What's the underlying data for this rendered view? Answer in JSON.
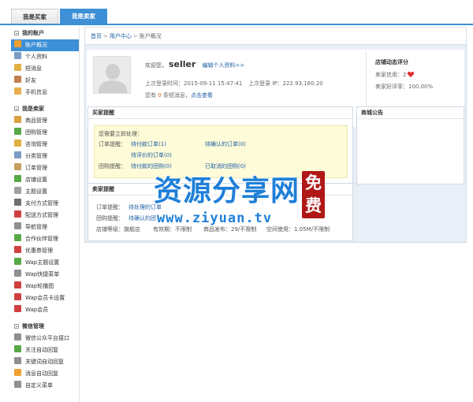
{
  "tabs": {
    "buyer": "我是买家",
    "seller": "我是卖家"
  },
  "sidebar": {
    "account": {
      "title": "我的账户",
      "items": [
        {
          "label": "账户概况",
          "icon": "home-icon",
          "color": "#f0a030",
          "active": true
        },
        {
          "label": "个人资料",
          "icon": "profile-icon",
          "color": "#7a9bc4"
        },
        {
          "label": "短消息",
          "icon": "message-icon",
          "color": "#e0b040"
        },
        {
          "label": "好友",
          "icon": "friends-icon",
          "color": "#c08050"
        },
        {
          "label": "手机信息",
          "icon": "phone-icon",
          "color": "#e8b050"
        }
      ]
    },
    "seller": {
      "title": "我是卖家",
      "items": [
        {
          "label": "商品管理",
          "icon": "goods-icon",
          "color": "#d9a040"
        },
        {
          "label": "团购管理",
          "icon": "groupbuy-icon",
          "color": "#58a848"
        },
        {
          "label": "咨询管理",
          "icon": "consult-icon",
          "color": "#e0b040"
        },
        {
          "label": "分类管理",
          "icon": "category-icon",
          "color": "#7a9bc4"
        },
        {
          "label": "订单管理",
          "icon": "order-icon",
          "color": "#c8a060"
        },
        {
          "label": "店铺设置",
          "icon": "shop-settings-icon",
          "color": "#58a848"
        },
        {
          "label": "主题设置",
          "icon": "theme-icon",
          "color": "#a0a0a0"
        },
        {
          "label": "支付方式管理",
          "icon": "payment-icon",
          "color": "#707070"
        },
        {
          "label": "配送方式管理",
          "icon": "delivery-icon",
          "color": "#d04040"
        },
        {
          "label": "导航管理",
          "icon": "navigation-icon",
          "color": "#909090"
        },
        {
          "label": "合作伙伴管理",
          "icon": "partner-icon",
          "color": "#58a848"
        },
        {
          "label": "优惠券管理",
          "icon": "coupon-icon",
          "color": "#d04040"
        },
        {
          "label": "Wap主题设置",
          "icon": "wap-theme-icon",
          "color": "#58a848"
        },
        {
          "label": "Wap快捷菜单",
          "icon": "wap-menu-icon",
          "color": "#909090"
        },
        {
          "label": "Wap轮播图",
          "icon": "wap-slider-icon",
          "color": "#d04040"
        },
        {
          "label": "Wap会员卡设置",
          "icon": "wap-card-icon",
          "color": "#d04040"
        },
        {
          "label": "Wap会员",
          "icon": "wap-member-icon",
          "color": "#d04040"
        }
      ]
    },
    "wechat": {
      "title": "微信管理",
      "items": [
        {
          "label": "微信公众平台接口",
          "icon": "wechat-api-icon",
          "color": "#909090"
        },
        {
          "label": "关注自动回复",
          "icon": "follow-reply-icon",
          "color": "#58a848"
        },
        {
          "label": "关键词自动回复",
          "icon": "keyword-reply-icon",
          "color": "#909090"
        },
        {
          "label": "消息自动回复",
          "icon": "message-reply-icon",
          "color": "#f0a030"
        },
        {
          "label": "自定义菜单",
          "icon": "custom-menu-icon",
          "color": "#909090"
        }
      ]
    }
  },
  "breadcrumb": {
    "home": "首页",
    "center": "用户中心",
    "current": "账户概况",
    "sep": ">"
  },
  "profile": {
    "welcome": "欢迎您，",
    "username": "seller",
    "edit_link": "编辑个人资料>>",
    "last_login_time": "上次登录时间：2015-09-11 15:47:41",
    "last_login_ip": "上次登录 IP：222.93.160.20",
    "msg_prefix": "您有",
    "msg_count": "0",
    "msg_suffix": "条短消息，",
    "msg_link": "点击查看"
  },
  "rating": {
    "title": "店铺动态评分",
    "credit_label": "卖家信用：2",
    "praise": "卖家好评率：100.00%"
  },
  "buyer_panel": {
    "title": "买家提醒",
    "todo": "您需要立即处理：",
    "order_label": "订单提醒：",
    "pay_order": "待付款订单(1)",
    "confirm_order": "待确认的订单(0)",
    "review_order": "待评价的订单(0)",
    "group_label": "团购提醒：",
    "pay_group": "待付款的团购(0)",
    "cancel_group": "已取消的团购(0)"
  },
  "notice_panel": {
    "title": "商城公告"
  },
  "seller_panel": {
    "title": "卖家提醒",
    "order_label": "订单提醒：",
    "pending_order": "待处理的订单",
    "group_label": "团购提醒：",
    "confirm_group": "待确认的团",
    "shop_level": "店铺等级：旗舰店",
    "valid_period": "有效期：不限制",
    "goods_publish": "商品发布：29/不限制",
    "space_usage": "空间使用：1.05M/不限制"
  },
  "watermark": {
    "title": "资源分享网",
    "url": "www.ziyuan.tv",
    "stamp_top": "免",
    "stamp_bottom": "费"
  }
}
